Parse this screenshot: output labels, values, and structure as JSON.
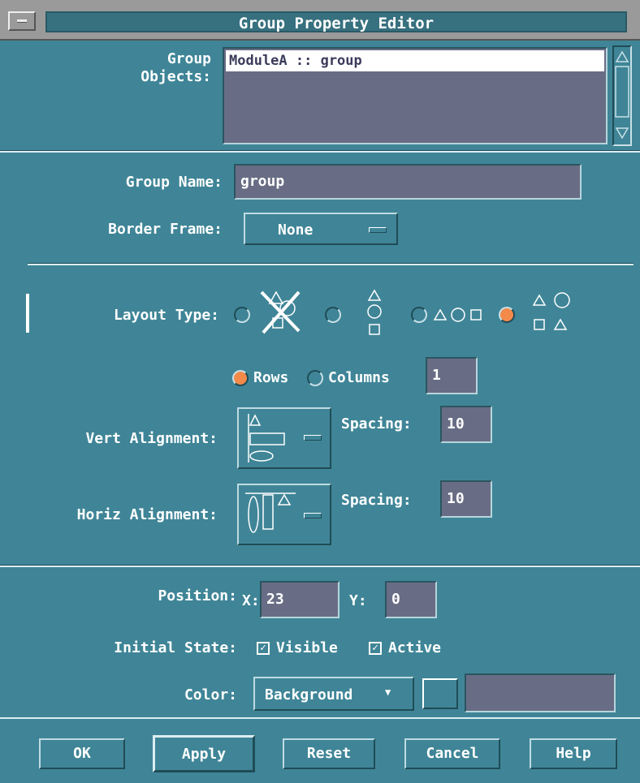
{
  "window": {
    "title": "Group Property Editor"
  },
  "group_objects": {
    "label": "Group\nObjects:",
    "items": [
      "ModuleA :: group"
    ]
  },
  "group_name": {
    "label": "Group Name:",
    "value": "group"
  },
  "border_frame": {
    "label": "Border Frame:",
    "value": "None"
  },
  "layout_type": {
    "label": "Layout Type:",
    "options": [
      "none",
      "vertical",
      "horizontal",
      "grid"
    ],
    "selected": "grid"
  },
  "rows_columns": {
    "rows_label": "Rows",
    "columns_label": "Columns",
    "selected": "Rows",
    "count": "1"
  },
  "vert_alignment": {
    "label": "Vert Alignment:",
    "spacing_label": "Spacing:",
    "spacing": "10"
  },
  "horiz_alignment": {
    "label": "Horiz Alignment:",
    "spacing_label": "Spacing:",
    "spacing": "10"
  },
  "position": {
    "label": "Position:",
    "x_label": "X:",
    "x": "23",
    "y_label": "Y:",
    "y": "0"
  },
  "initial_state": {
    "label": "Initial State:",
    "visible_label": "Visible",
    "visible": true,
    "active_label": "Active",
    "active": true
  },
  "color": {
    "label": "Color:",
    "value": "Background",
    "text": ""
  },
  "buttons": {
    "ok": "OK",
    "apply": "Apply",
    "reset": "Reset",
    "cancel": "Cancel",
    "help": "Help"
  },
  "colors": {
    "panel": "#3f8597",
    "field": "#686d85",
    "selected_radio": "#f48a4a"
  }
}
